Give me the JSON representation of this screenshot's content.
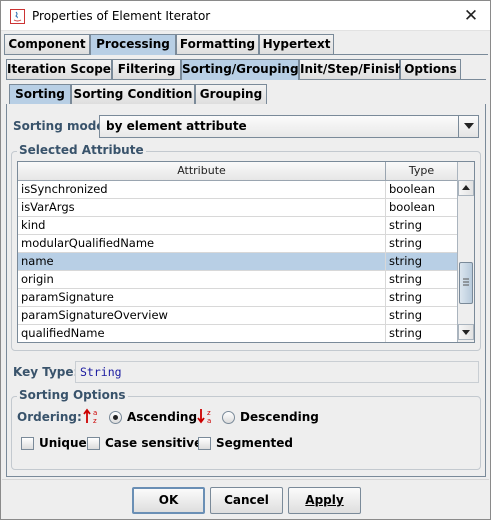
{
  "window": {
    "title": "Properties of Element Iterator",
    "close_glyph": "✕"
  },
  "main_tabs": [
    {
      "label": "Component",
      "selected": false
    },
    {
      "label": "Processing",
      "selected": true
    },
    {
      "label": "Formatting",
      "selected": false
    },
    {
      "label": "Hypertext",
      "selected": false
    }
  ],
  "sub_tabs": [
    {
      "label": "Iteration Scope",
      "selected": false
    },
    {
      "label": "Filtering",
      "selected": false
    },
    {
      "label": "Sorting/Grouping",
      "selected": true
    },
    {
      "label": "Init/Step/Finish",
      "selected": false
    },
    {
      "label": "Options",
      "selected": false
    }
  ],
  "inner_tabs": [
    {
      "label": "Sorting",
      "selected": true
    },
    {
      "label": "Sorting Condition",
      "selected": false
    },
    {
      "label": "Grouping",
      "selected": false
    }
  ],
  "sorting_mode": {
    "label": "Sorting mode:",
    "value": "by element attribute"
  },
  "selected_attribute": {
    "group_title": "Selected Attribute",
    "columns": [
      "Attribute",
      "Type"
    ],
    "rows": [
      {
        "attribute": "isSynchronized",
        "type": "boolean",
        "selected": false
      },
      {
        "attribute": "isVarArgs",
        "type": "boolean",
        "selected": false
      },
      {
        "attribute": "kind",
        "type": "string",
        "selected": false
      },
      {
        "attribute": "modularQualifiedName",
        "type": "string",
        "selected": false
      },
      {
        "attribute": "name",
        "type": "string",
        "selected": true
      },
      {
        "attribute": "origin",
        "type": "string",
        "selected": false
      },
      {
        "attribute": "paramSignature",
        "type": "string",
        "selected": false
      },
      {
        "attribute": "paramSignatureOverview",
        "type": "string",
        "selected": false
      },
      {
        "attribute": "qualifiedName",
        "type": "string",
        "selected": false
      }
    ]
  },
  "key_type": {
    "label": "Key Type:",
    "value": "String"
  },
  "sorting_options": {
    "group_title": "Sorting Options",
    "ordering_label": "Ordering:",
    "ascending_label": "Ascending",
    "descending_label": "Descending",
    "ordering_selected": "Ascending",
    "unique_label": "Unique",
    "case_sensitive_label": "Case sensitive",
    "segmented_label": "Segmented",
    "unique_checked": false,
    "case_sensitive_checked": false,
    "segmented_checked": false
  },
  "buttons": {
    "ok": "OK",
    "cancel": "Cancel",
    "apply": "Apply"
  },
  "colors": {
    "selected_tab": "#b8cfe5",
    "label_blue": "#39536b",
    "ascending_arrow": "#cc0000",
    "descending_arrow": "#cc0000"
  }
}
